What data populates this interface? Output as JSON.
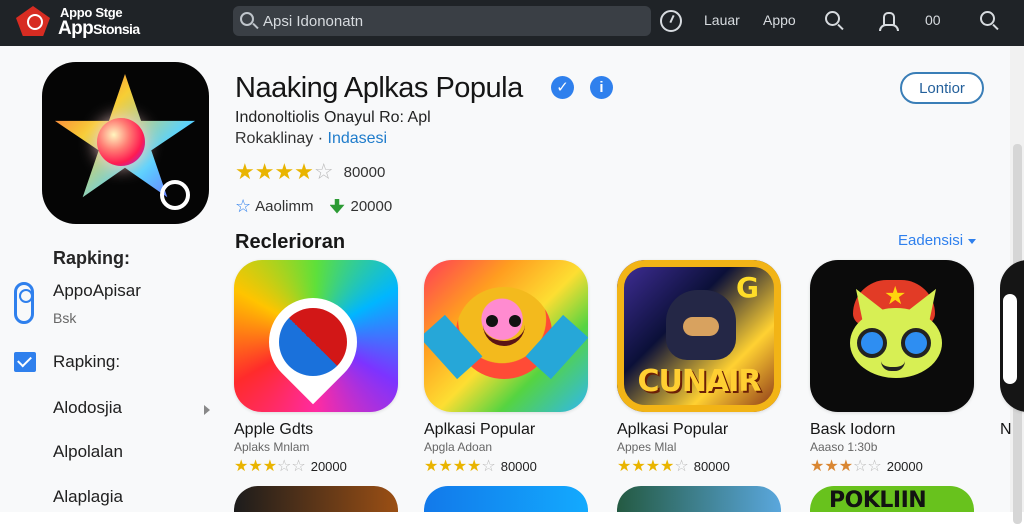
{
  "header": {
    "logo_line1": "Appo Stge",
    "logo_line2": "App",
    "logo_line2_small": "Stonsia",
    "search_placeholder": "Apsi Idononatn",
    "links": [
      "Lauar",
      "Appo"
    ],
    "overflow_label": "00"
  },
  "hero": {
    "title": "Naaking Aplkas Popula",
    "subtitle": "Indonoltiolis Onayul Ro: Apl",
    "category_label": "Rokaklinay",
    "category_value": "Indasesi",
    "follow_label": "Lontior",
    "rating_stars": 4.5,
    "rating_count": "80000",
    "meta_label": "Aaolimm",
    "meta_count": "20000"
  },
  "sidebar": {
    "title": "Rapking:",
    "items": [
      "AppoApisar",
      "Bsk",
      "Rapking:",
      "Alodosjia",
      "Alpolalan",
      "Alaplagia"
    ]
  },
  "section": {
    "title": "Reclerioran",
    "more_label": "Eadensisi"
  },
  "cards": [
    {
      "title": "Apple Gdts",
      "subtitle": "Aplaks Mnlam",
      "rating": 3.5,
      "count": "20000"
    },
    {
      "title": "Aplkasi Popular",
      "subtitle": "Apgla Adoan",
      "rating": 4.5,
      "count": "80000"
    },
    {
      "title": "Aplkasi Popular",
      "subtitle": "Appes Mlal",
      "rating": 4,
      "count": "80000"
    },
    {
      "title": "Bask Iodorn",
      "subtitle": "Aaaso 1:30b",
      "rating": 3.5,
      "count": "20000"
    }
  ],
  "bottom_card_text": "POKLIIN",
  "colors": {
    "topbar": "#1f2327",
    "accent": "#2f80ed",
    "star": "#e9b400"
  }
}
